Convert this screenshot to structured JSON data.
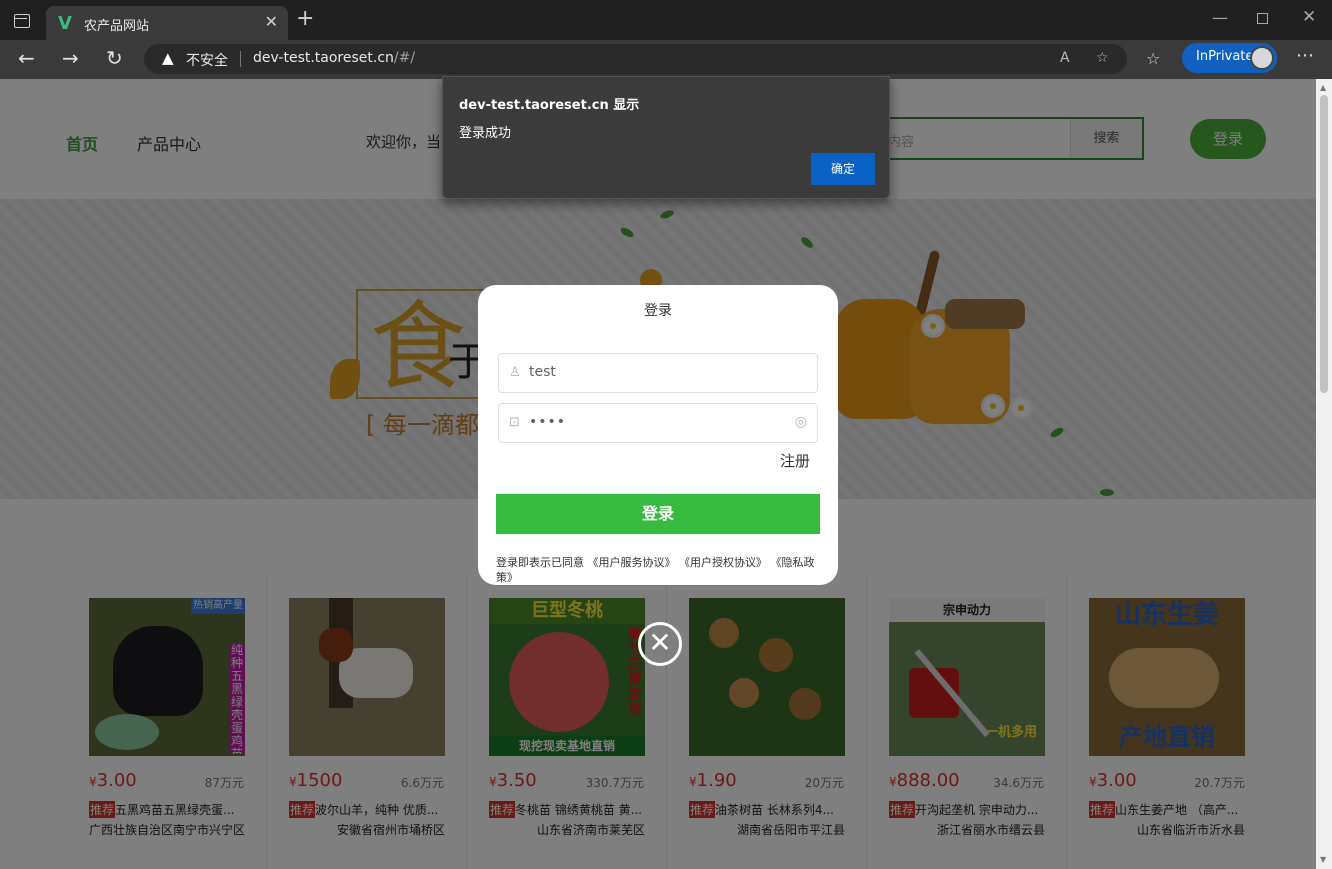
{
  "browser": {
    "tab_title": "农产品网站",
    "tab_favicon": "V",
    "security_label": "不安全",
    "url_host": "dev-test.taoreset.cn",
    "url_path": "/#/",
    "inprivate_label": "InPrivate"
  },
  "header": {
    "nav_home": "首页",
    "nav_products": "产品中心",
    "welcome": "欢迎你，当",
    "search_placeholder": "内容",
    "search_button": "搜索",
    "login_button": "登录"
  },
  "banner": {
    "big_char": "食",
    "second_char": "于",
    "subtitle": "[ 每一滴都"
  },
  "products": [
    {
      "price_symbol": "¥",
      "price": "3.00",
      "sales": "87万元",
      "tag": "推荐",
      "name": "五黑鸡苗五黑绿壳蛋...",
      "location": "广西壮族自治区南宁市兴宁区"
    },
    {
      "price_symbol": "¥",
      "price": "1500",
      "sales": "6.6万元",
      "tag": "推荐",
      "name": "波尔山羊，纯种 优质...",
      "location": "安徽省宿州市埇桥区"
    },
    {
      "price_symbol": "¥",
      "price": "3.50",
      "sales": "330.7万元",
      "tag": "推荐",
      "name": "冬桃苗 锦绣黄桃苗 黄...",
      "location": "山东省济南市莱芜区"
    },
    {
      "price_symbol": "¥",
      "price": "1.90",
      "sales": "20万元",
      "tag": "推荐",
      "name": "油茶树苗 长林系列4...",
      "location": "湖南省岳阳市平江县"
    },
    {
      "price_symbol": "¥",
      "price": "888.00",
      "sales": "34.6万元",
      "tag": "推荐",
      "name": "开沟起垄机 宗申动力...",
      "location": "浙江省丽水市缙云县"
    },
    {
      "price_symbol": "¥",
      "price": "3.00",
      "sales": "20.7万元",
      "tag": "推荐",
      "name": "山东生姜产地 （高产...",
      "location": "山东省临沂市沂水县"
    }
  ],
  "product_image_text": {
    "p1_side": "纯种五黑绿壳蛋鸡苗",
    "p1_corner": "热销高产量",
    "p3_top": "巨型冬桃",
    "p3_bottom": "现挖现卖基地直销",
    "p3_side": "春节正常发货",
    "p5_top": "宗申动力",
    "p5_bottom": "一机多用",
    "p6_top": "山东生姜",
    "p6_bottom": "产地直销"
  },
  "login_modal": {
    "title": "登录",
    "username_value": "test",
    "password_value": "••••",
    "register_link": "注册",
    "submit_label": "登录",
    "terms": "登录即表示已同意 《用户服务协议》 《用户授权协议》 《隐私政策》"
  },
  "alert": {
    "title": "dev-test.taoreset.cn 显示",
    "message": "登录成功",
    "ok_label": "确定"
  },
  "colors": {
    "brand_green": "#37bb3f",
    "price_red": "#d9322a",
    "alert_button": "#0a62c4"
  }
}
